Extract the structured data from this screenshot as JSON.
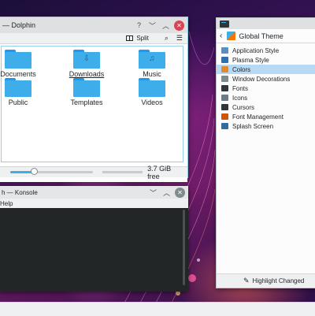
{
  "dolphin": {
    "title": "— Dolphin",
    "split_label": "Split",
    "places": [
      {
        "label": "Documents",
        "glyph": "",
        "underlined": false
      },
      {
        "label": "Downloads",
        "glyph": "⇩",
        "underlined": true
      },
      {
        "label": "Music",
        "glyph": "♫",
        "underlined": false
      },
      {
        "label": "Public",
        "glyph": "",
        "underlined": false
      },
      {
        "label": "Templates",
        "glyph": "",
        "underlined": false
      },
      {
        "label": "Videos",
        "glyph": "",
        "underlined": false
      }
    ],
    "zoom_level": 0.28,
    "free_space": "3.7 GiB free"
  },
  "konsole": {
    "title": "h — Konsole",
    "menu_help": "Help"
  },
  "settings": {
    "header": "Global Theme",
    "items": [
      {
        "label": "Application Style",
        "icon": "application-style-icon",
        "color": "#5a8fc4"
      },
      {
        "label": "Plasma Style",
        "icon": "plasma-style-icon",
        "color": "#2c70b8"
      },
      {
        "label": "Colors",
        "icon": "colors-icon",
        "color": "#e28a2b"
      },
      {
        "label": "Window Decorations",
        "icon": "window-decorations-icon",
        "color": "#7f8c8d"
      },
      {
        "label": "Fonts",
        "icon": "fonts-icon",
        "color": "#31363b"
      },
      {
        "label": "Icons",
        "icon": "icons-icon",
        "color": "#6c7a89"
      },
      {
        "label": "Cursors",
        "icon": "cursors-icon",
        "color": "#31363b"
      },
      {
        "label": "Font Management",
        "icon": "font-management-icon",
        "color": "#d35400"
      },
      {
        "label": "Splash Screen",
        "icon": "splash-screen-icon",
        "color": "#2e6da4"
      }
    ],
    "selected_index": 2,
    "footer": "Highlight Changed"
  },
  "colors": {
    "accent": "#3daee9",
    "close_red": "#da4453",
    "selection": "#b7d9f3"
  }
}
